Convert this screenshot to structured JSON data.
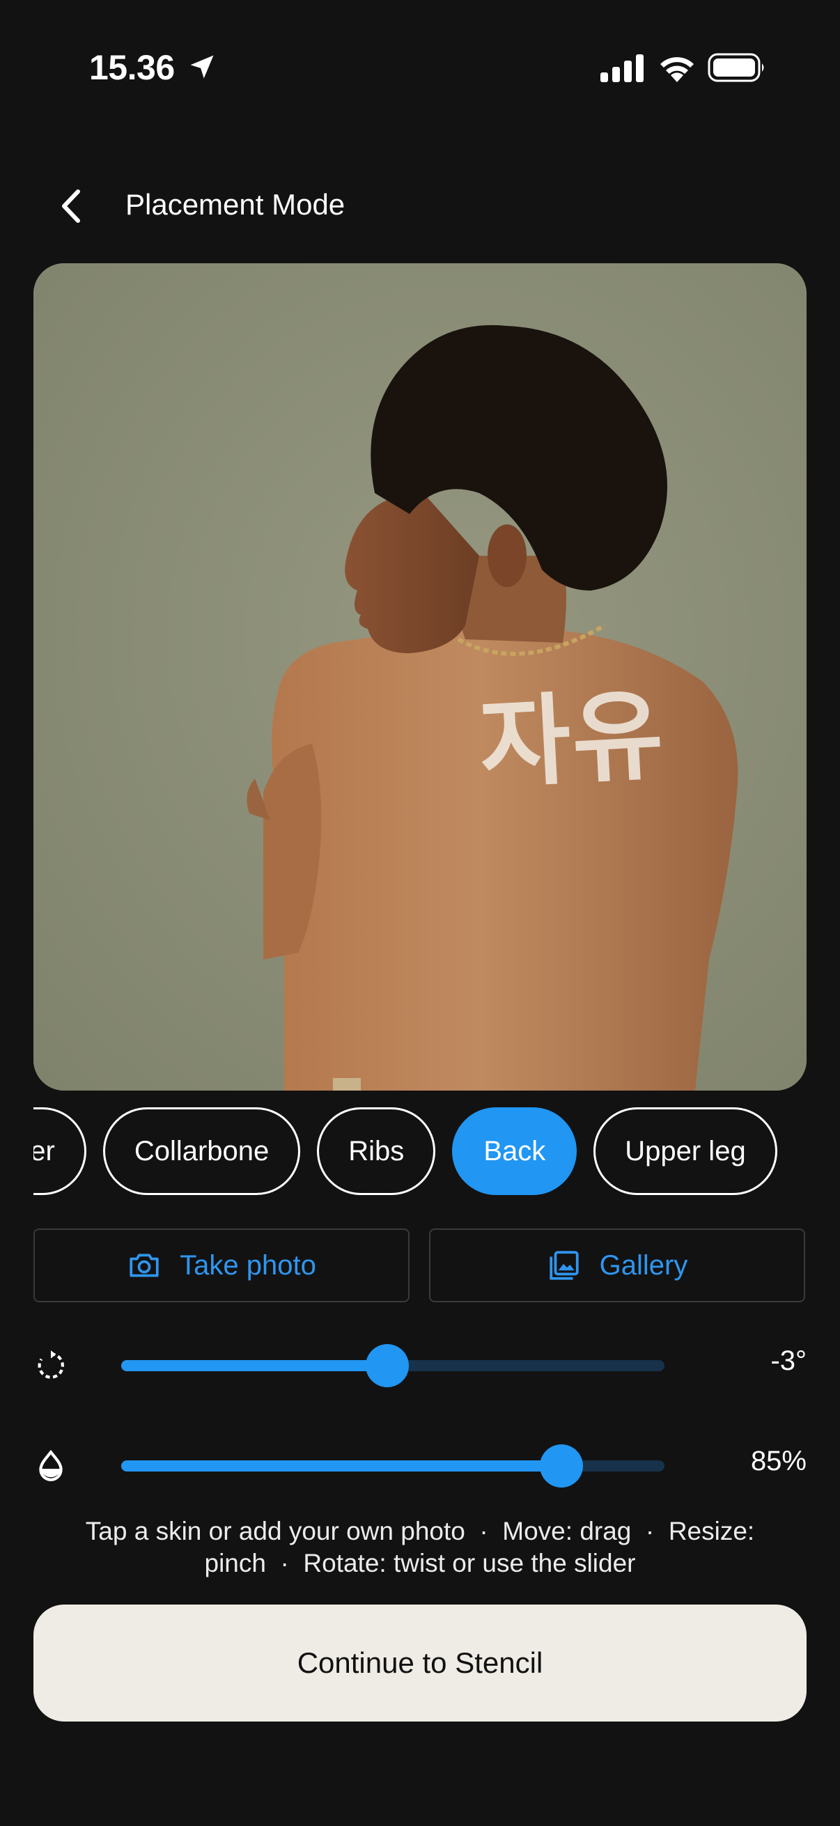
{
  "status_bar": {
    "time": "15.36",
    "icons": [
      "location-arrow-icon",
      "cellular-signal-icon",
      "wifi-icon",
      "battery-icon"
    ]
  },
  "header": {
    "back_icon": "chevron-left-icon",
    "title": "Placement Mode"
  },
  "preview": {
    "overlay_text": "자유"
  },
  "placements": {
    "items": [
      "Shoulder",
      "Collarbone",
      "Ribs",
      "Back",
      "Upper leg"
    ],
    "visible_labels": [
      "der",
      "Collarbone",
      "Ribs",
      "Back",
      "Upper leg"
    ],
    "selected": "Back"
  },
  "source": {
    "take_photo_label": "Take photo",
    "take_photo_icon": "camera-icon",
    "gallery_label": "Gallery",
    "gallery_icon": "gallery-icon"
  },
  "sliders": {
    "rotation": {
      "icon": "rotate-icon",
      "value_text": "-3°",
      "fraction": 0.49
    },
    "opacity": {
      "icon": "opacity-drop-icon",
      "value_text": "85%",
      "fraction": 0.81
    }
  },
  "hint": {
    "line1": "Tap a skin or add your own photo  ·  Move: drag  ·  Resize:",
    "line2": "pinch  ·  Rotate: twist or use the slider"
  },
  "continue_label": "Continue to Stencil",
  "colors": {
    "background": "#121212",
    "accent": "#2196f3",
    "track": "#17324a",
    "continue_bg": "#efebe5"
  }
}
